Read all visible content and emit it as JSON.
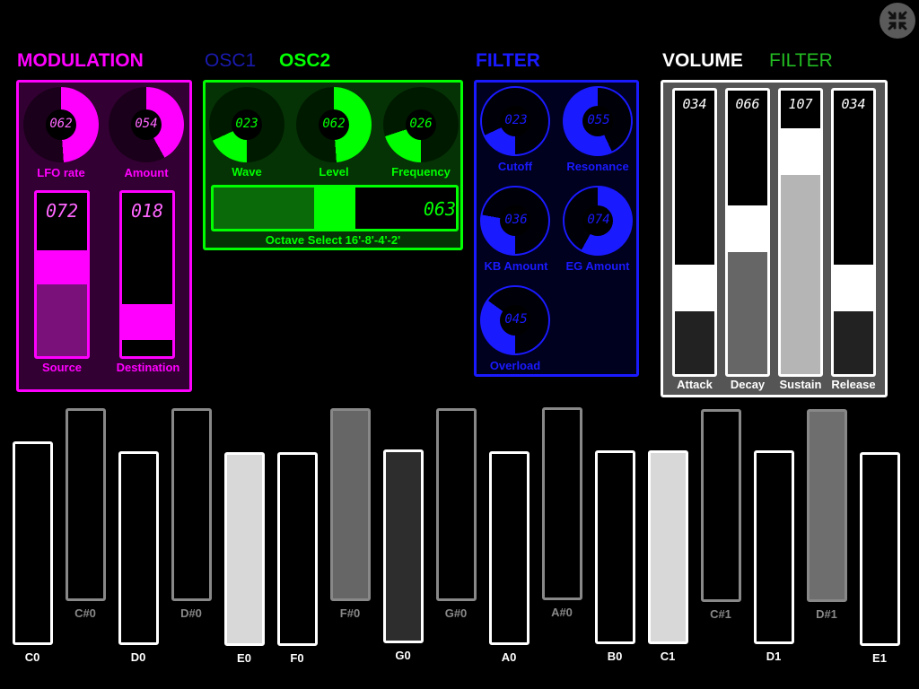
{
  "collapse_icon": "collapse-arrows-icon",
  "colors": {
    "modulation": "#ff00ff",
    "osc2": "#00ff00",
    "osc1_dim": "#1a1ab0",
    "filter": "#1a1aff",
    "volume": "#ffffff",
    "filter_tab_inactive": "#22bb22"
  },
  "headers": {
    "modulation": "MODULATION",
    "osc1": "OSC1",
    "osc2": "OSC2",
    "filter": "FILTER",
    "volume": "VOLUME",
    "filter_tab": "FILTER"
  },
  "modulation": {
    "knobs": [
      {
        "label": "LFO rate",
        "value": "062",
        "level": 0.49
      },
      {
        "label": "Amount",
        "value": "054",
        "level": 0.42
      }
    ],
    "sliders": [
      {
        "label": "Source",
        "value": "072"
      },
      {
        "label": "Destination",
        "value": "018"
      }
    ]
  },
  "osc2": {
    "knobs": [
      {
        "label": "Wave",
        "value": "023",
        "level": 0.18
      },
      {
        "label": "Level",
        "value": "062",
        "level": 0.49
      },
      {
        "label": "Frequency",
        "value": "026",
        "level": 0.2
      }
    ],
    "octave": {
      "label": "Octave Select 16'-8'-4'-2'",
      "value": "063"
    }
  },
  "filter": {
    "knobs": [
      {
        "label": "Cutoff",
        "value": "023",
        "level": 0.18
      },
      {
        "label": "Resonance",
        "value": "055",
        "level": 0.43
      },
      {
        "label": "KB Amount",
        "value": "036",
        "level": 0.28
      },
      {
        "label": "EG Amount",
        "value": "074",
        "level": 0.58
      },
      {
        "label": "Overload",
        "value": "045",
        "level": 0.35
      }
    ]
  },
  "volume": {
    "sliders": [
      {
        "label": "Attack",
        "value": "034"
      },
      {
        "label": "Decay",
        "value": "066"
      },
      {
        "label": "Sustain",
        "value": "107"
      },
      {
        "label": "Release",
        "value": "034"
      }
    ]
  },
  "keyboard": {
    "naturals": [
      "C0",
      "D0",
      "E0",
      "F0",
      "G0",
      "A0",
      "B0",
      "C1",
      "D1",
      "E1"
    ],
    "sharps": [
      "C#0",
      "D#0",
      "F#0",
      "G#0",
      "A#0",
      "C#1",
      "D#1"
    ]
  }
}
